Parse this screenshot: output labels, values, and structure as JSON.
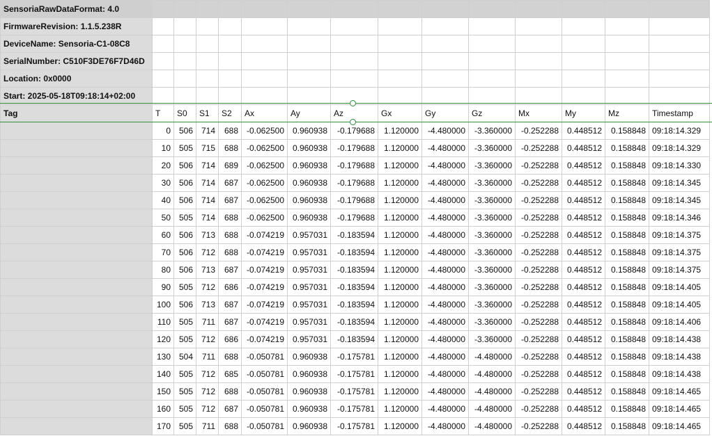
{
  "meta_rows": [
    "SensoriaRawDataFormat: 4.0",
    "FirmwareRevision: 1.1.5.238R",
    "DeviceName: Sensoria-C1-08C8",
    "SerialNumber: C510F3DE76F7D46D",
    "Location: 0x0000",
    "Start: 2025-05-18T09:18:14+02:00"
  ],
  "headers": [
    "Tag",
    "T",
    "S0",
    "S1",
    "S2",
    "Ax",
    "Ay",
    "Az",
    "Gx",
    "Gy",
    "Gz",
    "Mx",
    "My",
    "Mz",
    "Timestamp"
  ],
  "rows": [
    [
      "0",
      "506",
      "714",
      "688",
      "-0.062500",
      "0.960938",
      "-0.179688",
      "1.120000",
      "-4.480000",
      "-3.360000",
      "-0.252288",
      "0.448512",
      "0.158848",
      "09:18:14.329"
    ],
    [
      "10",
      "505",
      "715",
      "688",
      "-0.062500",
      "0.960938",
      "-0.179688",
      "1.120000",
      "-4.480000",
      "-3.360000",
      "-0.252288",
      "0.448512",
      "0.158848",
      "09:18:14.329"
    ],
    [
      "20",
      "506",
      "714",
      "689",
      "-0.062500",
      "0.960938",
      "-0.179688",
      "1.120000",
      "-4.480000",
      "-3.360000",
      "-0.252288",
      "0.448512",
      "0.158848",
      "09:18:14.330"
    ],
    [
      "30",
      "506",
      "714",
      "687",
      "-0.062500",
      "0.960938",
      "-0.179688",
      "1.120000",
      "-4.480000",
      "-3.360000",
      "-0.252288",
      "0.448512",
      "0.158848",
      "09:18:14.345"
    ],
    [
      "40",
      "506",
      "714",
      "687",
      "-0.062500",
      "0.960938",
      "-0.179688",
      "1.120000",
      "-4.480000",
      "-3.360000",
      "-0.252288",
      "0.448512",
      "0.158848",
      "09:18:14.345"
    ],
    [
      "50",
      "505",
      "714",
      "688",
      "-0.062500",
      "0.960938",
      "-0.179688",
      "1.120000",
      "-4.480000",
      "-3.360000",
      "-0.252288",
      "0.448512",
      "0.158848",
      "09:18:14.346"
    ],
    [
      "60",
      "506",
      "713",
      "688",
      "-0.074219",
      "0.957031",
      "-0.183594",
      "1.120000",
      "-4.480000",
      "-3.360000",
      "-0.252288",
      "0.448512",
      "0.158848",
      "09:18:14.375"
    ],
    [
      "70",
      "506",
      "712",
      "688",
      "-0.074219",
      "0.957031",
      "-0.183594",
      "1.120000",
      "-4.480000",
      "-3.360000",
      "-0.252288",
      "0.448512",
      "0.158848",
      "09:18:14.375"
    ],
    [
      "80",
      "506",
      "713",
      "687",
      "-0.074219",
      "0.957031",
      "-0.183594",
      "1.120000",
      "-4.480000",
      "-3.360000",
      "-0.252288",
      "0.448512",
      "0.158848",
      "09:18:14.375"
    ],
    [
      "90",
      "505",
      "712",
      "686",
      "-0.074219",
      "0.957031",
      "-0.183594",
      "1.120000",
      "-4.480000",
      "-3.360000",
      "-0.252288",
      "0.448512",
      "0.158848",
      "09:18:14.405"
    ],
    [
      "100",
      "506",
      "713",
      "687",
      "-0.074219",
      "0.957031",
      "-0.183594",
      "1.120000",
      "-4.480000",
      "-3.360000",
      "-0.252288",
      "0.448512",
      "0.158848",
      "09:18:14.405"
    ],
    [
      "110",
      "505",
      "711",
      "687",
      "-0.074219",
      "0.957031",
      "-0.183594",
      "1.120000",
      "-4.480000",
      "-3.360000",
      "-0.252288",
      "0.448512",
      "0.158848",
      "09:18:14.406"
    ],
    [
      "120",
      "505",
      "712",
      "686",
      "-0.074219",
      "0.957031",
      "-0.183594",
      "1.120000",
      "-4.480000",
      "-3.360000",
      "-0.252288",
      "0.448512",
      "0.158848",
      "09:18:14.438"
    ],
    [
      "130",
      "504",
      "711",
      "688",
      "-0.050781",
      "0.960938",
      "-0.175781",
      "1.120000",
      "-4.480000",
      "-4.480000",
      "-0.252288",
      "0.448512",
      "0.158848",
      "09:18:14.438"
    ],
    [
      "140",
      "505",
      "712",
      "685",
      "-0.050781",
      "0.960938",
      "-0.175781",
      "1.120000",
      "-4.480000",
      "-4.480000",
      "-0.252288",
      "0.448512",
      "0.158848",
      "09:18:14.438"
    ],
    [
      "150",
      "505",
      "712",
      "688",
      "-0.050781",
      "0.960938",
      "-0.175781",
      "1.120000",
      "-4.480000",
      "-4.480000",
      "-0.252288",
      "0.448512",
      "0.158848",
      "09:18:14.465"
    ],
    [
      "160",
      "505",
      "712",
      "687",
      "-0.050781",
      "0.960938",
      "-0.175781",
      "1.120000",
      "-4.480000",
      "-4.480000",
      "-0.252288",
      "0.448512",
      "0.158848",
      "09:18:14.465"
    ],
    [
      "170",
      "505",
      "711",
      "688",
      "-0.050781",
      "0.960938",
      "-0.175781",
      "1.120000",
      "-4.480000",
      "-4.480000",
      "-0.252288",
      "0.448512",
      "0.158848",
      "09:18:14.465"
    ]
  ]
}
